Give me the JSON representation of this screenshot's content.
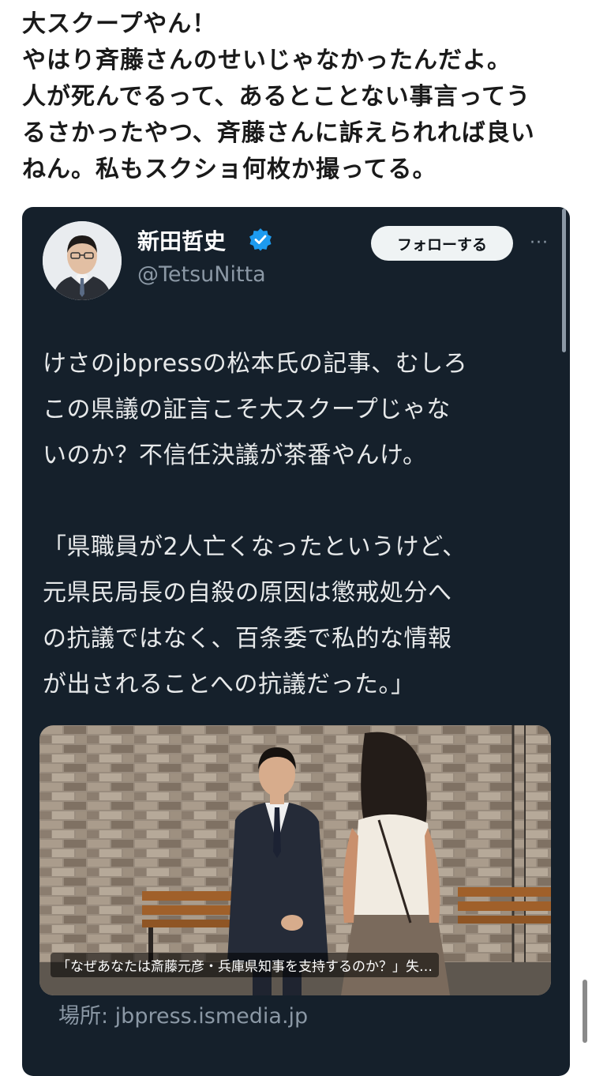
{
  "post": {
    "lines": [
      "大スクープやん！",
      "やはり斉藤さんのせいじゃなかったんだよ。",
      "人が死んでるって、あるとことない事言ってう",
      "るさかったやつ、斉藤さんに訴えられれば良い",
      "ねん。私もスクショ何枚か撮ってる。"
    ]
  },
  "embed": {
    "display_name": "新田哲史",
    "handle": "@TetsuNitta",
    "follow_label": "フォローする",
    "more_label": "···",
    "body_lines_1": [
      "けさのjbpressの松本氏の記事、むしろ",
      "この県議の証言こそ大スクープじゃな",
      "いのか？不信任決議が茶番やんけ。"
    ],
    "body_lines_2": [
      "「県職員が2人亡くなったというけど、",
      "元県民局長の自殺の原因は懲戒処分へ",
      "の抗議ではなく、百条委で私的な情報",
      "が出されることへの抗議だった。」"
    ],
    "card": {
      "caption": "「なぜあなたは斎藤元彦・兵庫県知事を支持するのか？」失…",
      "domain": "場所: jbpress.ismedia.jp"
    }
  },
  "icons": {
    "verified": "verified-badge-icon",
    "more": "more-options-icon",
    "avatar": "avatar"
  },
  "colors": {
    "embed_bg": "#15202b",
    "verified": "#1d9bf0",
    "follow_bg": "#eff3f4",
    "muted": "#8b98a5"
  }
}
